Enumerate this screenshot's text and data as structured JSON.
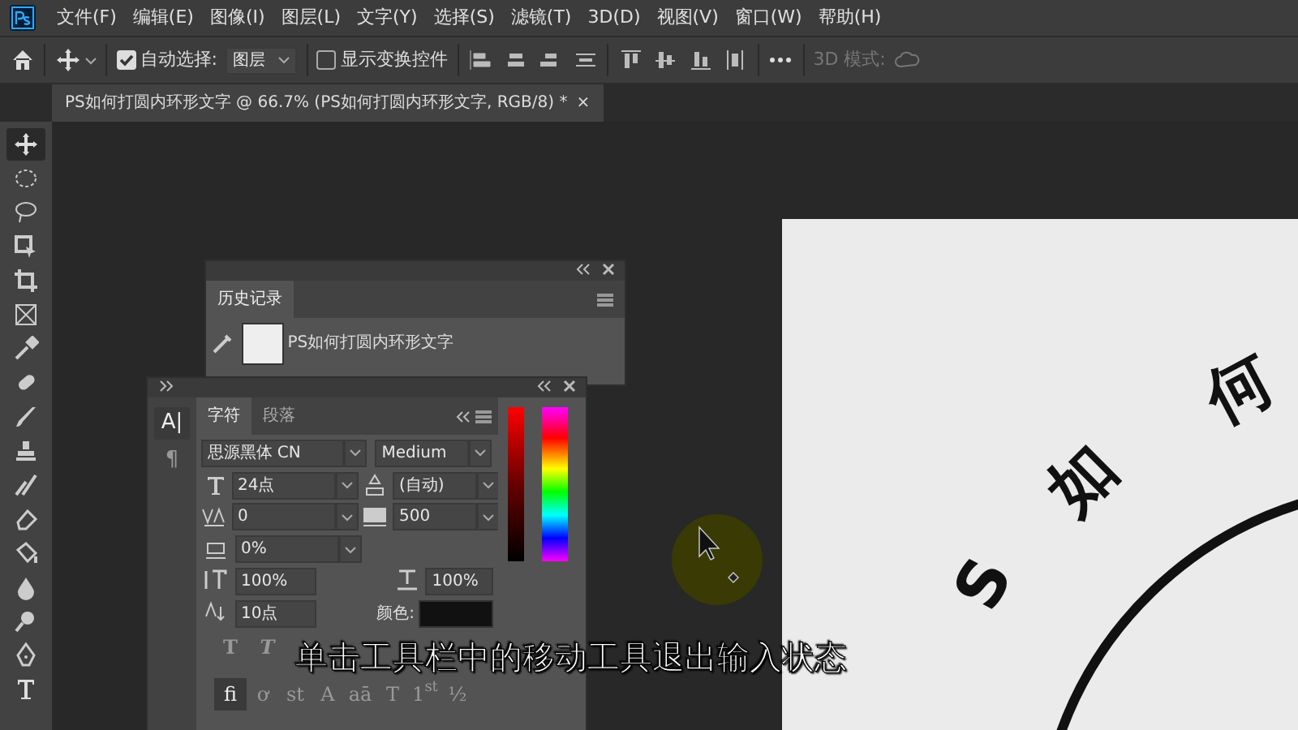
{
  "menu": [
    "文件(F)",
    "编辑(E)",
    "图像(I)",
    "图层(L)",
    "文字(Y)",
    "选择(S)",
    "滤镜(T)",
    "3D(D)",
    "视图(V)",
    "窗口(W)",
    "帮助(H)"
  ],
  "options_bar": {
    "auto_select": {
      "label": "自动选择:",
      "checked": true
    },
    "target": "图层",
    "show_transform": {
      "label": "显示变换控件",
      "checked": false
    },
    "mode_label": "3D 模式:"
  },
  "document_tab": {
    "title": "PS如何打圆内环形文字 @ 66.7% (PS如何打圆内环形文字, RGB/8) *",
    "close": "×"
  },
  "tools": [
    {
      "selected": true
    },
    {
      "selected": false
    },
    {
      "selected": false
    },
    {
      "selected": false
    },
    {
      "selected": false
    },
    {
      "selected": false
    },
    {
      "selected": false
    },
    {
      "selected": false
    },
    {
      "selected": false
    },
    {
      "selected": false
    },
    {
      "selected": false
    },
    {
      "selected": false
    },
    {
      "selected": false
    },
    {
      "selected": false
    },
    {
      "selected": false
    },
    {
      "selected": false
    },
    {
      "selected": false
    }
  ],
  "history_panel": {
    "tab": "历史记录",
    "entries": [
      {
        "label": "PS如何打圆内环形文字"
      }
    ]
  },
  "character_panel": {
    "side_buttons": [
      {
        "label": "A|",
        "selected": true
      },
      {
        "label": "¶",
        "selected": false
      }
    ],
    "tabs": [
      {
        "label": "字符",
        "selected": true
      },
      {
        "label": "段落",
        "selected": false
      }
    ],
    "font_family": "思源黑体 CN",
    "font_style": "Medium",
    "size": "24点",
    "leading": "(自动)",
    "kerning": "0",
    "tracking": "500",
    "tsume": "0%",
    "vertical_scale": "100%",
    "horizontal_scale": "100%",
    "baseline_shift": "10点",
    "color_label": "颜色:",
    "style_buttons": [
      "T",
      "T"
    ],
    "opentype_buttons": [
      {
        "label": "fi",
        "selected": true
      },
      {
        "label": "ơ",
        "selected": false
      },
      {
        "label": "st",
        "selected": false
      },
      {
        "label": "A",
        "selected": false
      },
      {
        "label": "aā",
        "selected": false
      },
      {
        "label": "T",
        "selected": false
      },
      {
        "label": "1$^{st}$",
        "selected": false
      },
      {
        "label": "½",
        "selected": false
      }
    ]
  },
  "canvas_text": [
    "S",
    "如",
    "何"
  ],
  "caption": "单击工具栏中的移动工具退出输入状态"
}
